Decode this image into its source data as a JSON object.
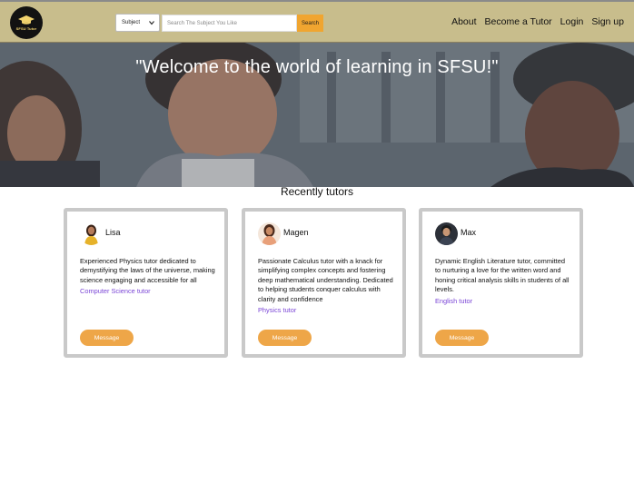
{
  "header": {
    "logo_text": "SFSU Tutor",
    "subject_select": "Subject",
    "search_placeholder": "Search The Subject You Like",
    "search_button": "Search",
    "nav": [
      "About",
      "Become a Tutor",
      "Login",
      "Sign up"
    ]
  },
  "hero": {
    "title": "\"Welcome to the world of learning in SFSU!\""
  },
  "section": {
    "title": "Recently tutors"
  },
  "tutors": [
    {
      "name": "Lisa",
      "bio": "Experienced Physics tutor dedicated to demystifying the laws of the universe, making science engaging and accessible for all",
      "subject": "Computer Science tutor",
      "button": "Message"
    },
    {
      "name": "Magen",
      "bio": "Passionate Calculus tutor with a knack for simplifying complex concepts and fostering deep mathematical understanding. Dedicated to helping students conquer calculus with clarity and confidence",
      "subject": "Physics tutor",
      "button": "Message"
    },
    {
      "name": "Max",
      "bio": "Dynamic English Literature tutor, committed to nurturing a love for the written word and honing critical analysis skills in students of all levels.",
      "subject": "English tutor",
      "button": "Message"
    }
  ],
  "colors": {
    "header_bg": "#c8bd8c",
    "accent": "#f0a530",
    "subject_link": "#7a45d6"
  }
}
